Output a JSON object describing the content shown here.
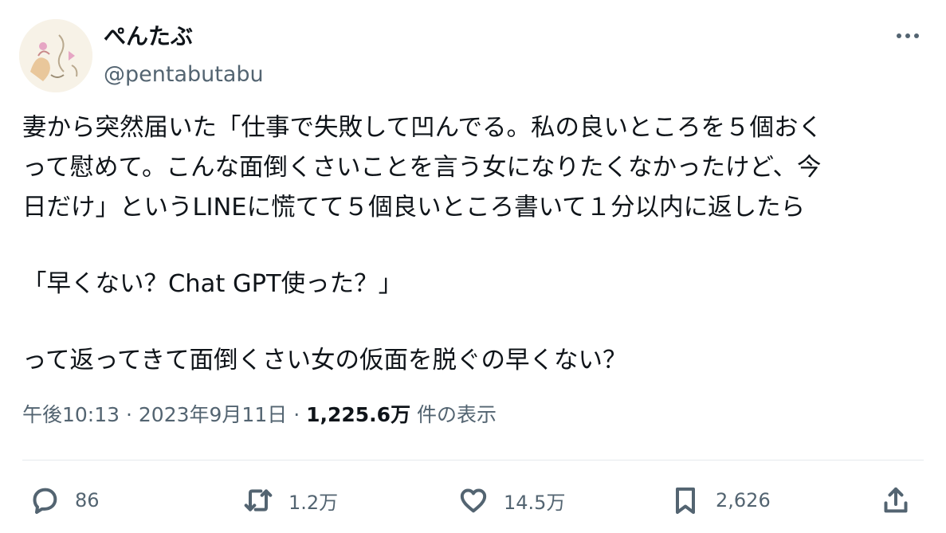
{
  "author": {
    "display_name": "ぺんたぶ",
    "handle": "@pentabutabu"
  },
  "tweet": {
    "lines": [
      "妻から突然届いた「仕事で失敗して凹んでる。私の良いところを５個おく",
      "って慰めて。こんな面倒くさいことを言う女になりたくなかったけど、今",
      "日だけ」というLINEに慌てて５個良いところ書いて１分以内に返したら",
      "「早くない？Chat GPT使った？」",
      "って返ってきて面倒くさい女の仮面を脱ぐの早くない？"
    ]
  },
  "meta": {
    "time": "午後10:13",
    "date": "2023年9月11日",
    "separator": "·",
    "views_count": "1,225.6万",
    "views_label": "件の表示"
  },
  "actions": {
    "reply_count": "86",
    "retweet_count": "1.2万",
    "like_count": "14.5万",
    "bookmark_count": "2,626"
  },
  "icons": {
    "more": "more-horizontal-icon",
    "reply": "reply-icon",
    "retweet": "retweet-icon",
    "like": "heart-icon",
    "bookmark": "bookmark-icon",
    "share": "share-icon"
  },
  "colors": {
    "text": "#0f1419",
    "secondary": "#536471",
    "divider": "#e5e9ec"
  }
}
